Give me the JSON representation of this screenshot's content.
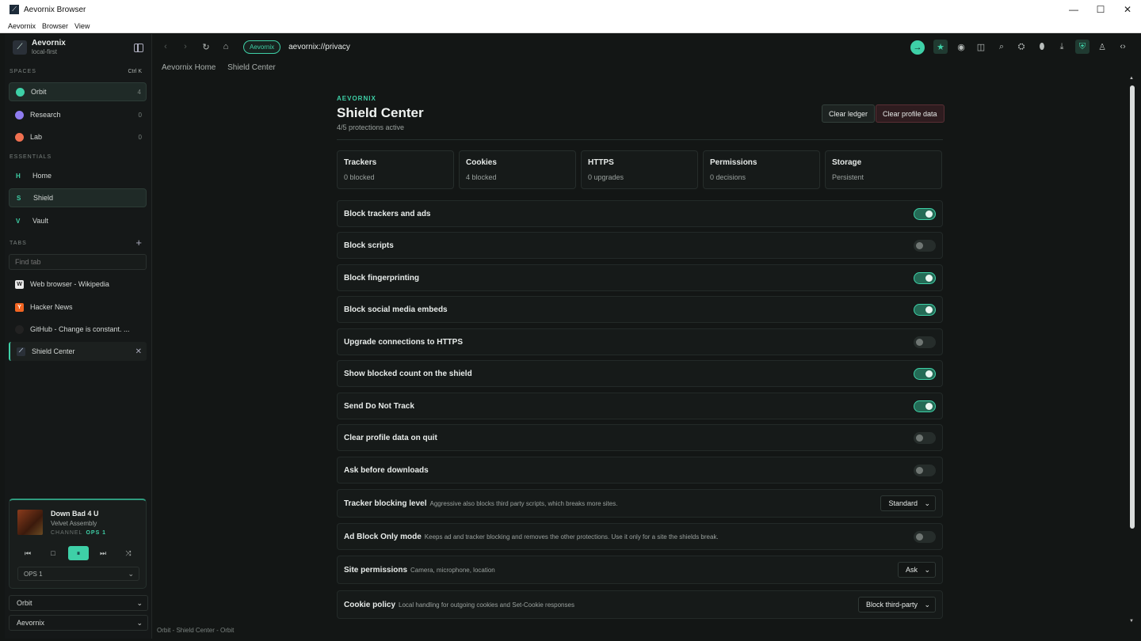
{
  "window": {
    "title": "Aevornix Browser",
    "menu": [
      "Aevornix",
      "Browser",
      "View"
    ]
  },
  "sidebar": {
    "brand": {
      "name": "Aevornix",
      "subtitle": "local-first"
    },
    "spaces_label": "SPACES",
    "shortcut": "Ctrl K",
    "spaces": [
      {
        "label": "Orbit",
        "count": "4",
        "color": "#3ed0a7"
      },
      {
        "label": "Research",
        "count": "0",
        "color": "#8f7cf0"
      },
      {
        "label": "Lab",
        "count": "0",
        "color": "#f07050"
      }
    ],
    "essentials_label": "ESSENTIALS",
    "essentials": [
      {
        "icon": "H",
        "label": "Home"
      },
      {
        "icon": "S",
        "label": "Shield"
      },
      {
        "icon": "V",
        "label": "Vault"
      }
    ],
    "tabs_label": "TABS",
    "find_placeholder": "Find tab",
    "tabs": [
      {
        "label": "Web browser - Wikipedia",
        "fav": "W"
      },
      {
        "label": "Hacker News",
        "fav": "Y"
      },
      {
        "label": "GitHub - Change is constant. ...",
        "fav": ""
      },
      {
        "label": "Shield Center",
        "fav": ""
      }
    ],
    "player": {
      "title": "Down Bad 4 U",
      "artist": "Velvet Assembly",
      "channel_label": "CHANNEL",
      "channel": "OPS 1",
      "select": "OPS 1"
    },
    "space_select": "Orbit",
    "profile_select": "Aevornix"
  },
  "toolbar": {
    "chip": "Aevornix",
    "url": "aevornix://privacy"
  },
  "breadcrumbs": [
    "Aevornix Home",
    "Shield Center"
  ],
  "page": {
    "eyebrow": "AEVORNIX",
    "title": "Shield Center",
    "subtitle": "4/5 protections active",
    "clear_ledger": "Clear ledger",
    "clear_profile": "Clear profile data",
    "stats": [
      {
        "k": "Trackers",
        "v": "0 blocked"
      },
      {
        "k": "Cookies",
        "v": "4 blocked"
      },
      {
        "k": "HTTPS",
        "v": "0 upgrades"
      },
      {
        "k": "Permissions",
        "v": "0 decisions"
      },
      {
        "k": "Storage",
        "v": "Persistent"
      }
    ],
    "toggles": [
      {
        "label": "Block trackers and ads",
        "on": true
      },
      {
        "label": "Block scripts",
        "on": false
      },
      {
        "label": "Block fingerprinting",
        "on": true
      },
      {
        "label": "Block social media embeds",
        "on": true
      },
      {
        "label": "Upgrade connections to HTTPS",
        "on": false
      },
      {
        "label": "Show blocked count on the shield",
        "on": true
      },
      {
        "label": "Send Do Not Track",
        "on": true
      },
      {
        "label": "Clear profile data on quit",
        "on": false
      },
      {
        "label": "Ask before downloads",
        "on": false
      }
    ],
    "tracker_level": {
      "label": "Tracker blocking level",
      "desc": "Aggressive also blocks third party scripts, which breaks more sites.",
      "value": "Standard"
    },
    "adblock_only": {
      "label": "Ad Block Only mode",
      "desc": "Keeps ad and tracker blocking and removes the other protections. Use it only for a site the shields break.",
      "on": false
    },
    "site_permissions": {
      "label": "Site permissions",
      "desc": "Camera, microphone, location",
      "value": "Ask"
    },
    "cookie_policy": {
      "label": "Cookie policy",
      "desc": "Local handling for outgoing cookies and Set-Cookie responses",
      "value": "Block third-party"
    }
  },
  "status": "Orbit - Shield Center - Orbit"
}
